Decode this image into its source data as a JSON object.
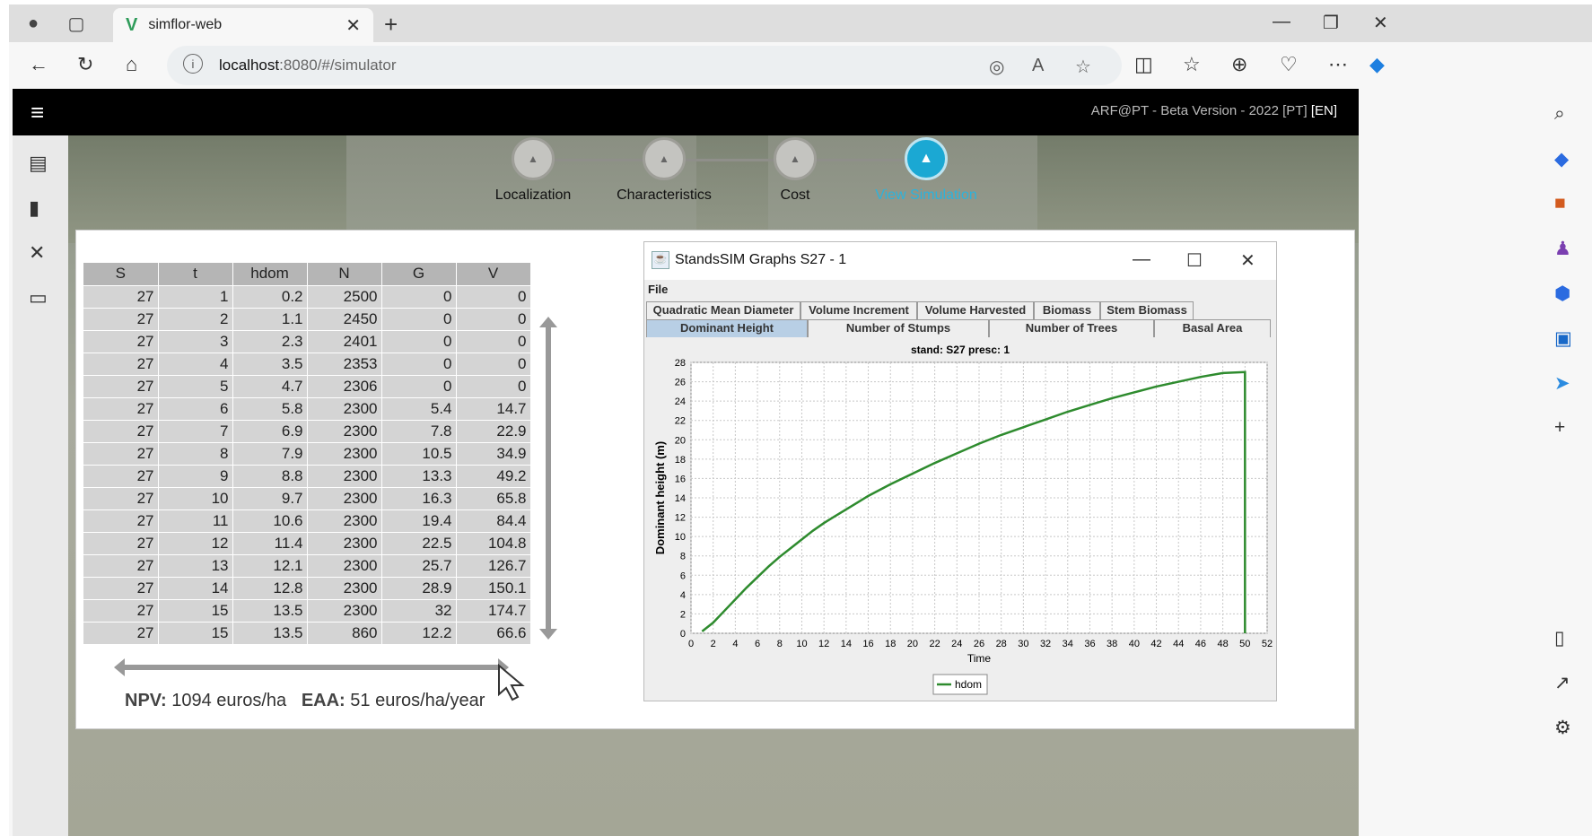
{
  "browser": {
    "tab_title": "simflor-web",
    "url_host": "localhost",
    "url_rest": ":8080/#/simulator"
  },
  "app": {
    "brand": "ARF@PT - Beta Version - 2022",
    "lang_pt": "[PT]",
    "lang_en": "[EN]"
  },
  "stepper": {
    "steps": [
      "Localization",
      "Characteristics",
      "Cost",
      "View Simulation"
    ],
    "active_index": 3
  },
  "table": {
    "headers": [
      "S",
      "t",
      "hdom",
      "N",
      "G",
      "V"
    ],
    "rows": [
      [
        "27",
        "1",
        "0.2",
        "2500",
        "0",
        "0"
      ],
      [
        "27",
        "2",
        "1.1",
        "2450",
        "0",
        "0"
      ],
      [
        "27",
        "3",
        "2.3",
        "2401",
        "0",
        "0"
      ],
      [
        "27",
        "4",
        "3.5",
        "2353",
        "0",
        "0"
      ],
      [
        "27",
        "5",
        "4.7",
        "2306",
        "0",
        "0"
      ],
      [
        "27",
        "6",
        "5.8",
        "2300",
        "5.4",
        "14.7"
      ],
      [
        "27",
        "7",
        "6.9",
        "2300",
        "7.8",
        "22.9"
      ],
      [
        "27",
        "8",
        "7.9",
        "2300",
        "10.5",
        "34.9"
      ],
      [
        "27",
        "9",
        "8.8",
        "2300",
        "13.3",
        "49.2"
      ],
      [
        "27",
        "10",
        "9.7",
        "2300",
        "16.3",
        "65.8"
      ],
      [
        "27",
        "11",
        "10.6",
        "2300",
        "19.4",
        "84.4"
      ],
      [
        "27",
        "12",
        "11.4",
        "2300",
        "22.5",
        "104.8"
      ],
      [
        "27",
        "13",
        "12.1",
        "2300",
        "25.7",
        "126.7"
      ],
      [
        "27",
        "14",
        "12.8",
        "2300",
        "28.9",
        "150.1"
      ],
      [
        "27",
        "15",
        "13.5",
        "2300",
        "32",
        "174.7"
      ],
      [
        "27",
        "15",
        "13.5",
        "860",
        "12.2",
        "66.6"
      ]
    ]
  },
  "summary": {
    "npv_label": "NPV:",
    "npv_value": "1094 euros/ha",
    "eaa_label": "EAA:",
    "eaa_value": "51 euros/ha/year"
  },
  "graph_window": {
    "title": "StandsSIM Graphs S27 - 1",
    "menu_file": "File",
    "tabs_row1": [
      "Quadratic Mean Diameter",
      "Volume Increment",
      "Volume Harvested",
      "Biomass",
      "Stem Biomass"
    ],
    "tabs_row2": [
      "Dominant Height",
      "Number of Stumps",
      "Number of Trees",
      "Basal Area"
    ],
    "selected_tab": "Dominant Height"
  },
  "chart_data": {
    "type": "line",
    "title": "stand: S27   presc: 1",
    "xlabel": "Time",
    "ylabel": "Dominant height (m)",
    "xlim": [
      0,
      52
    ],
    "ylim": [
      0,
      28
    ],
    "xticks": [
      0,
      2,
      4,
      6,
      8,
      10,
      12,
      14,
      16,
      18,
      20,
      22,
      24,
      26,
      28,
      30,
      32,
      34,
      36,
      38,
      40,
      42,
      44,
      46,
      48,
      50,
      52
    ],
    "yticks": [
      0,
      2,
      4,
      6,
      8,
      10,
      12,
      14,
      16,
      18,
      20,
      22,
      24,
      26,
      28
    ],
    "grid": true,
    "legend": "bottom-center",
    "series": [
      {
        "name": "hdom",
        "color": "#2e8b2e",
        "x": [
          1,
          2,
          3,
          4,
          5,
          6,
          7,
          8,
          9,
          10,
          11,
          12,
          13,
          14,
          15,
          16,
          18,
          20,
          22,
          24,
          26,
          28,
          30,
          32,
          34,
          36,
          38,
          40,
          42,
          44,
          46,
          48,
          50,
          50
        ],
        "y": [
          0.2,
          1.1,
          2.3,
          3.5,
          4.7,
          5.8,
          6.9,
          7.9,
          8.8,
          9.7,
          10.6,
          11.4,
          12.1,
          12.8,
          13.5,
          14.2,
          15.4,
          16.5,
          17.6,
          18.6,
          19.6,
          20.5,
          21.3,
          22.1,
          22.9,
          23.6,
          24.3,
          24.9,
          25.5,
          26.0,
          26.5,
          26.9,
          27.0,
          0
        ]
      }
    ]
  }
}
